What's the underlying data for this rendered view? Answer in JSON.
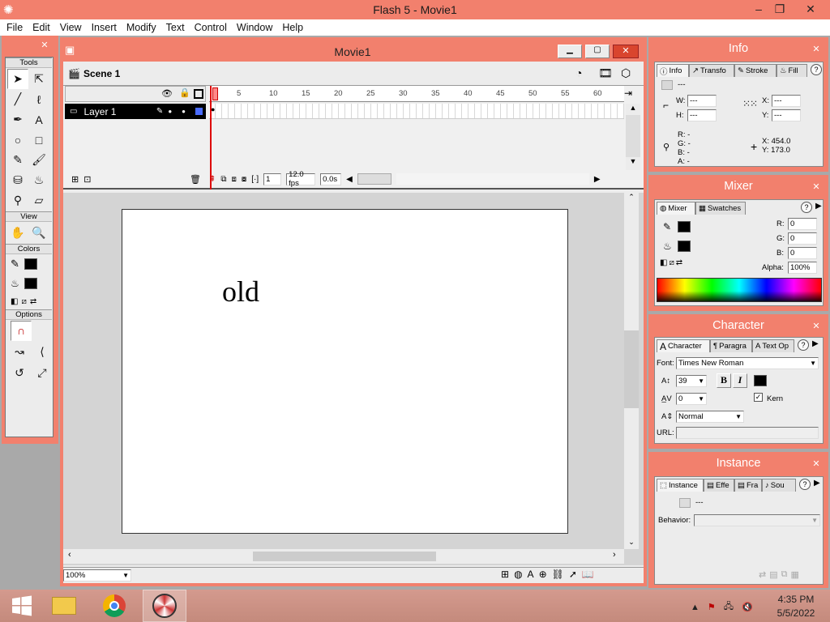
{
  "window": {
    "title": "Flash 5 - Movie1",
    "minimize": "‒",
    "restore": "❐",
    "close": "✕"
  },
  "menu": [
    "File",
    "Edit",
    "View",
    "Insert",
    "Modify",
    "Text",
    "Control",
    "Window",
    "Help"
  ],
  "tools": {
    "title": "Tools",
    "sections": {
      "view": "View",
      "colors": "Colors",
      "options": "Options"
    },
    "items": [
      {
        "name": "arrow-tool-icon",
        "glyph": "➤"
      },
      {
        "name": "subselect-tool-icon",
        "glyph": "⇱"
      },
      {
        "name": "line-tool-icon",
        "glyph": "╱"
      },
      {
        "name": "lasso-tool-icon",
        "glyph": "ℓ"
      },
      {
        "name": "pen-tool-icon",
        "glyph": "✒"
      },
      {
        "name": "text-tool-icon",
        "glyph": "A"
      },
      {
        "name": "oval-tool-icon",
        "glyph": "○"
      },
      {
        "name": "rectangle-tool-icon",
        "glyph": "□"
      },
      {
        "name": "pencil-tool-icon",
        "glyph": "✎"
      },
      {
        "name": "brush-tool-icon",
        "glyph": "🖌"
      },
      {
        "name": "ink-bottle-tool-icon",
        "glyph": "⛁"
      },
      {
        "name": "paint-bucket-tool-icon",
        "glyph": "♨"
      },
      {
        "name": "eyedropper-tool-icon",
        "glyph": "⚲"
      },
      {
        "name": "eraser-tool-icon",
        "glyph": "▱"
      }
    ],
    "view_items": [
      {
        "name": "hand-tool-icon",
        "glyph": "✋"
      },
      {
        "name": "zoom-tool-icon",
        "glyph": "🔍"
      }
    ]
  },
  "movie": {
    "title": "Movie1",
    "scene": "Scene 1",
    "layer": "Layer 1",
    "ruler": [
      "5",
      "10",
      "15",
      "20",
      "25",
      "30",
      "35",
      "40",
      "45",
      "50",
      "55",
      "60"
    ],
    "current_frame": "1",
    "fps": "12.0 fps",
    "elapsed": "0.0s",
    "stage_text": "old",
    "zoom": "100%"
  },
  "info": {
    "title": "Info",
    "tabs": [
      "Info",
      "Transfo",
      "Stroke",
      "Fill"
    ],
    "dash": "---",
    "w": "W:",
    "h": "H:",
    "x": "X:",
    "y": "Y:",
    "w_val": "---",
    "h_val": "---",
    "x_val": "---",
    "y_val": "---",
    "r": "R:  -",
    "g": "G:  -",
    "b": "B:  -",
    "a": "A:  -",
    "cursor_x": "X:   454.0",
    "cursor_y": "Y:   173.0"
  },
  "mixer": {
    "title": "Mixer",
    "tabs": [
      "Mixer",
      "Swatches"
    ],
    "r_label": "R:",
    "g_label": "G:",
    "b_label": "B:",
    "alpha_label": "Alpha:",
    "r": "0",
    "g": "0",
    "b": "0",
    "alpha": "100%"
  },
  "character": {
    "title": "Character",
    "tabs": [
      "Character",
      "Paragra",
      "Text Op"
    ],
    "font_label": "Font:",
    "font": "Times New Roman",
    "size": "39",
    "tracking": "0",
    "bold": "B",
    "italic": "I",
    "kern": "Kern",
    "kern_checked": true,
    "baseline": "Normal",
    "url_label": "URL:"
  },
  "instance": {
    "title": "Instance",
    "tabs": [
      "Instance",
      "Effe",
      "Fra",
      "Sou"
    ],
    "dash": "---",
    "behavior_label": "Behavior:"
  },
  "taskbar": {
    "time": "4:35 PM",
    "date": "5/5/2022"
  },
  "colors": {
    "frame": "#f2806d",
    "accent": "#f2806d"
  }
}
